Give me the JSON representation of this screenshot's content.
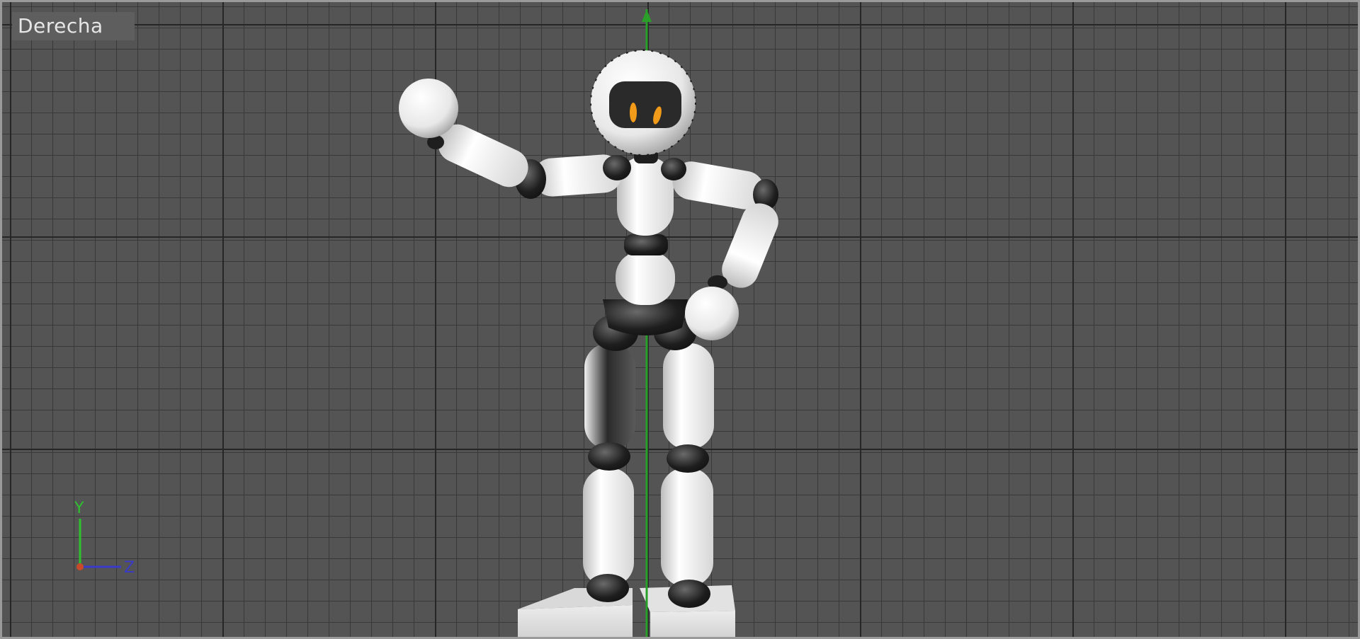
{
  "viewport": {
    "label": "Derecha",
    "background_color": "#545454",
    "grid_major_color": "#262626",
    "grid_minor_color": "#393939",
    "frame_color": "#9a9a9a",
    "vertical_axis_color": "#2aa02a"
  },
  "figure": {
    "body_color": "#f0f0f0",
    "joint_color": "#1e1e1e",
    "eye_color": "#f29a1a",
    "visor_color": "#2a2a2a"
  },
  "axis_gizmo": {
    "y_label": "Y",
    "z_label": "Z",
    "y_color": "#2ec02e",
    "z_color": "#3a3ac8",
    "x_color": "#c84a2a"
  }
}
